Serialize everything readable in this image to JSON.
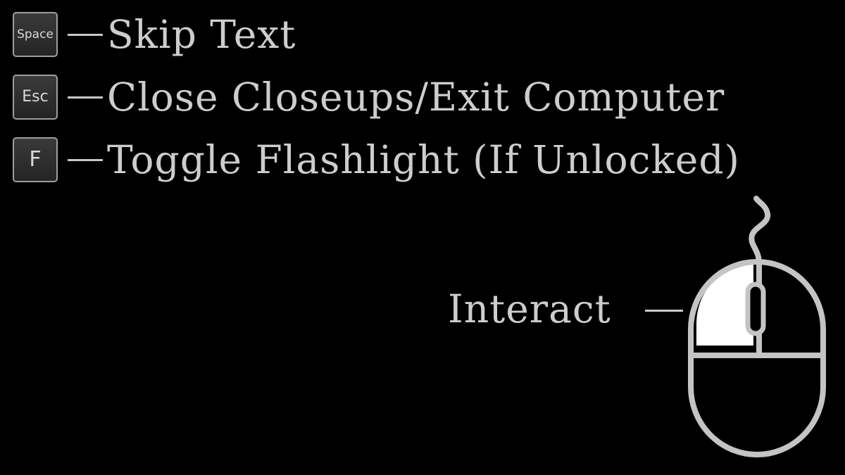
{
  "controls": [
    {
      "key": "Space",
      "action": "Skip Text"
    },
    {
      "key": "Esc",
      "action": "Close Closeups/Exit Computer"
    },
    {
      "key": "F",
      "action": "Toggle Flashlight (If Unlocked)"
    }
  ],
  "mouse": {
    "action": "Interact",
    "icon": "mouse-left-click-icon"
  },
  "colors": {
    "background": "#000000",
    "text": "#cdcdcd",
    "key_border": "#9e9e9e",
    "mouse_outline": "#c4c4c4",
    "mouse_highlight": "#ffffff"
  }
}
